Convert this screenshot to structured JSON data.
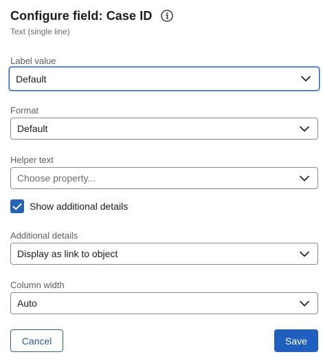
{
  "header": {
    "title": "Configure field: Case ID",
    "subtitle": "Text (single line)",
    "info_icon": "info-icon"
  },
  "fields": {
    "label_value": {
      "label": "Label value",
      "value": "Default"
    },
    "format": {
      "label": "Format",
      "value": "Default"
    },
    "helper_text": {
      "label": "Helper text",
      "placeholder": "Choose property..."
    },
    "additional_details": {
      "label": "Additional details",
      "value": "Display as link to object"
    },
    "column_width": {
      "label": "Column width",
      "value": "Auto"
    }
  },
  "show_additional_details": {
    "label": "Show additional details",
    "checked": true
  },
  "actions": {
    "cancel_label": "Cancel",
    "save_label": "Save"
  },
  "colors": {
    "accent": "#1f5fbf",
    "checkbox": "#2563b8",
    "border": "#8a8a8a",
    "label_text": "#5e5e5e"
  },
  "icons": {
    "dropdown": "chevron-down-icon",
    "check": "check-icon"
  }
}
